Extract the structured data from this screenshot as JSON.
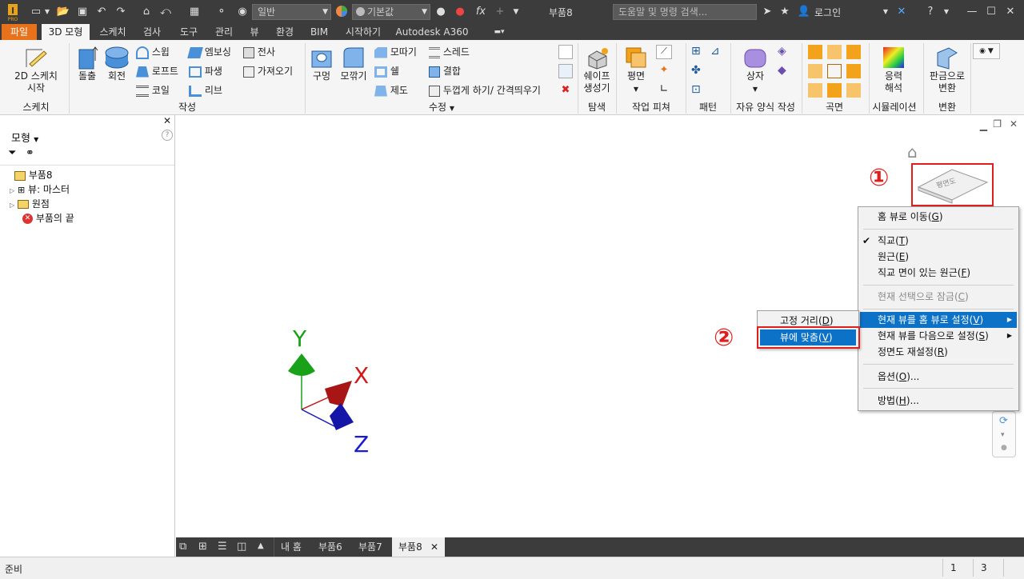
{
  "titlebar": {
    "document_title": "부품8",
    "appearance_combo": "일반",
    "material_combo": "기본값",
    "search_placeholder": "도움말 및 명령 검색...",
    "login": "로그인"
  },
  "tabs": [
    "파일",
    "3D 모형",
    "스케치",
    "검사",
    "도구",
    "관리",
    "뷰",
    "환경",
    "BIM",
    "시작하기",
    "Autodesk A360"
  ],
  "ribbon": {
    "sketch": {
      "btn_line1": "2D 스케치",
      "btn_line2": "시작",
      "group": "스케치"
    },
    "create": {
      "extrude": "돌출",
      "revolve": "회전",
      "sweep": "스윕",
      "loft": "로프트",
      "coil": "코일",
      "emboss": "엠보싱",
      "derive": "파생",
      "rib": "리브",
      "decal": "전사",
      "import": "가져오기",
      "group": "작성"
    },
    "modify": {
      "hole": "구멍",
      "fillet": "모깎기",
      "chamfer": "모따기",
      "shell": "쉘",
      "draft": "제도",
      "thread": "스레드",
      "combine": "결합",
      "thicken": "두껍게 하기/ 간격띄우기",
      "group": "수정"
    },
    "explore": {
      "shape_line1": "쉐이프",
      "shape_line2": "생성기",
      "group": "탐색"
    },
    "work": {
      "plane": "평면",
      "group": "작업 피쳐"
    },
    "pattern": {
      "group": "패턴"
    },
    "freeform": {
      "box": "상자",
      "group": "자유 양식 작성"
    },
    "surface": {
      "group": "곡면"
    },
    "simulation": {
      "line1": "응력",
      "line2": "해석",
      "group": "시뮬레이션"
    },
    "convert": {
      "line1": "판금으로",
      "line2": "변환",
      "group": "변환"
    }
  },
  "browser": {
    "title": "모형",
    "items": [
      "부품8",
      "뷰: 마스터",
      "원점",
      "부품의 끝"
    ]
  },
  "viewcube": {
    "face": "평면도"
  },
  "axes": {
    "x": "X",
    "y": "Y",
    "z": "Z"
  },
  "annotations": {
    "one": "①",
    "two": "②"
  },
  "context_menu": {
    "items": [
      {
        "label": "홈 뷰로 이동",
        "key": "G"
      },
      {
        "label": "직교",
        "key": "T",
        "checked": true
      },
      {
        "label": "원근",
        "key": "E"
      },
      {
        "label": "직교 면이 있는 원근",
        "key": "F"
      },
      {
        "label": "현재 선택으로 잠금",
        "key": "C",
        "disabled": true
      },
      {
        "label": "현재 뷰를 홈 뷰로 설정",
        "key": "V",
        "submenu": true,
        "highlighted": true
      },
      {
        "label": "현재 뷰를 다음으로 설정",
        "key": "S",
        "submenu": true
      },
      {
        "label": "정면도 재설정",
        "key": "R"
      },
      {
        "label": "옵션",
        "key": "O",
        "suffix": "..."
      },
      {
        "label": "방법",
        "key": "H",
        "suffix": "..."
      }
    ]
  },
  "submenu": {
    "items": [
      {
        "label": "고정 거리",
        "key": "D"
      },
      {
        "label": "뷰에 맞춤",
        "key": "V",
        "highlighted": true
      }
    ]
  },
  "doc_tabs": [
    "내 홈",
    "부품6",
    "부품7",
    "부품8"
  ],
  "status": {
    "text": "준비",
    "count1": "1",
    "count2": "3"
  },
  "colors": {
    "accent": "#0c72c8",
    "file_tab": "#e8711b",
    "annotation": "#e01e1e",
    "dark": "#3c3c3c"
  }
}
